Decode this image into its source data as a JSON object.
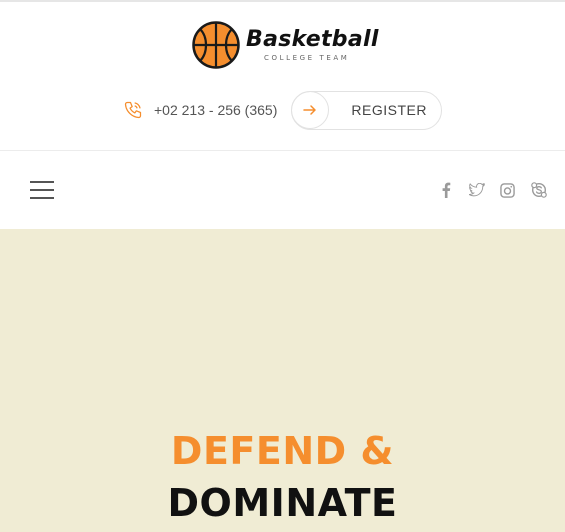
{
  "brand": {
    "title": "Basketball",
    "subtitle": "COLLEGE TEAM",
    "ball_color": "#f58e2e"
  },
  "contact": {
    "phone": "+02 213 - 256 (365)",
    "phone_icon": "phone-icon"
  },
  "register": {
    "label": "REGISTER",
    "icon": "arrow-right-icon"
  },
  "nav": {
    "menu_icon": "hamburger-menu-icon",
    "social": [
      "facebook-icon",
      "twitter-icon",
      "instagram-icon",
      "skype-icon"
    ]
  },
  "hero": {
    "line1": "DEFEND &",
    "line2": "DOMINATE",
    "background": "#f0ecd4",
    "accent": "#f58e2e"
  }
}
